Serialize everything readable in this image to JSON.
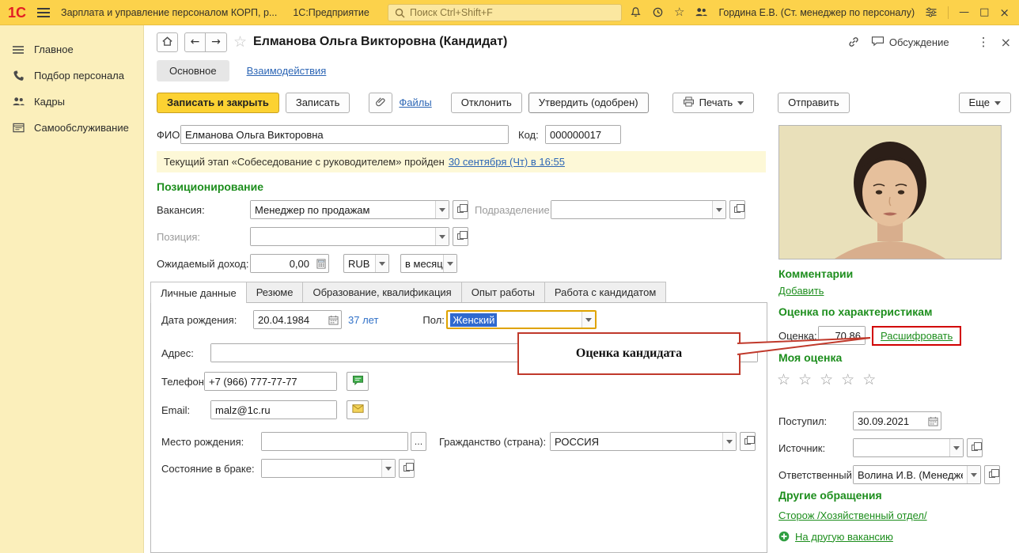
{
  "colors": {
    "topbar_yellow": "#fcd24b",
    "sidebar_yellow": "#fbefbb",
    "accent_green": "#1d8e1d",
    "link_blue": "#2d66b5",
    "primary_button_yellow": "#fcd232",
    "annotation_red": "#c0392b"
  },
  "glyphs": {
    "back": "←",
    "forward": "→",
    "star": "☆",
    "dots": "⋮",
    "close": "×",
    "minimize": "—",
    "maximize": "□",
    "ellipsis": "..."
  },
  "topbar": {
    "logo": "1С",
    "app_title": "Зарплата и управление персоналом КОРП, р...",
    "product": "1С:Предприятие",
    "search_placeholder": "Поиск Ctrl+Shift+F",
    "user": "Гордина Е.В. (Ст. менеджер по персоналу)"
  },
  "sidebar": {
    "items": [
      {
        "label": "Главное"
      },
      {
        "label": "Подбор персонала"
      },
      {
        "label": "Кадры"
      },
      {
        "label": "Самообслуживание"
      }
    ]
  },
  "doc": {
    "title": "Елманова Ольга Викторовна (Кандидат)",
    "discussion": "Обсуждение"
  },
  "main_tabs": {
    "main": "Основное",
    "interactions": "Взаимодействия"
  },
  "toolbar": {
    "save_close": "Записать и закрыть",
    "save": "Записать",
    "files": "Файлы",
    "reject": "Отклонить",
    "approve": "Утвердить (одобрен)",
    "print": "Печать",
    "send": "Отправить",
    "more": "Еще"
  },
  "form": {
    "fio_label": "ФИО:",
    "fio_value": "Елманова Ольга Викторовна",
    "code_label": "Код:",
    "code_value": "000000017",
    "stage_text": "Текущий этап «Собеседование с руководителем» пройден",
    "stage_link": "30 сентября (Чт) в 16:55",
    "positioning": "Позиционирование",
    "vacancy_label": "Вакансия:",
    "vacancy_value": "Менеджер по продажам",
    "department_label": "Подразделение:",
    "position_label": "Позиция:",
    "income_label": "Ожидаемый доход:",
    "income_value": "0,00",
    "currency_value": "RUB",
    "period_value": "в месяц"
  },
  "detail_tabs": [
    "Личные данные",
    "Резюме",
    "Образование, квалификация",
    "Опыт работы",
    "Работа с кандидатом"
  ],
  "personal": {
    "birthdate_label": "Дата рождения:",
    "birthdate_value": "20.04.1984",
    "age_text": "37 лет",
    "gender_label": "Пол:",
    "gender_value": "Женский",
    "address_label": "Адрес:",
    "phone_label": "Телефон:",
    "phone_value": "+7 (966) 777-77-77",
    "email_label": "Email:",
    "email_value": "malz@1c.ru",
    "birthplace_label": "Место рождения:",
    "citizenship_label": "Гражданство (страна):",
    "citizenship_value": "РОССИЯ",
    "marital_label": "Состояние в браке:"
  },
  "callout": {
    "text": "Оценка кандидата"
  },
  "right": {
    "comments": "Комментарии",
    "add": "Добавить",
    "characteristics": "Оценка по характеристикам",
    "score_label": "Оценка:",
    "score_value": "70,86",
    "decode": "Расшифровать",
    "my_rating": "Моя оценка",
    "received_label": "Поступил:",
    "received_value": "30.09.2021",
    "source_label": "Источник:",
    "responsible_label": "Ответственный:",
    "responsible_value": "Волина И.В. (Менедже",
    "other_requests": "Другие обращения",
    "other_link": "Сторож /Хозяйственный отдел/",
    "to_other_vacancy": "На другую вакансию"
  }
}
